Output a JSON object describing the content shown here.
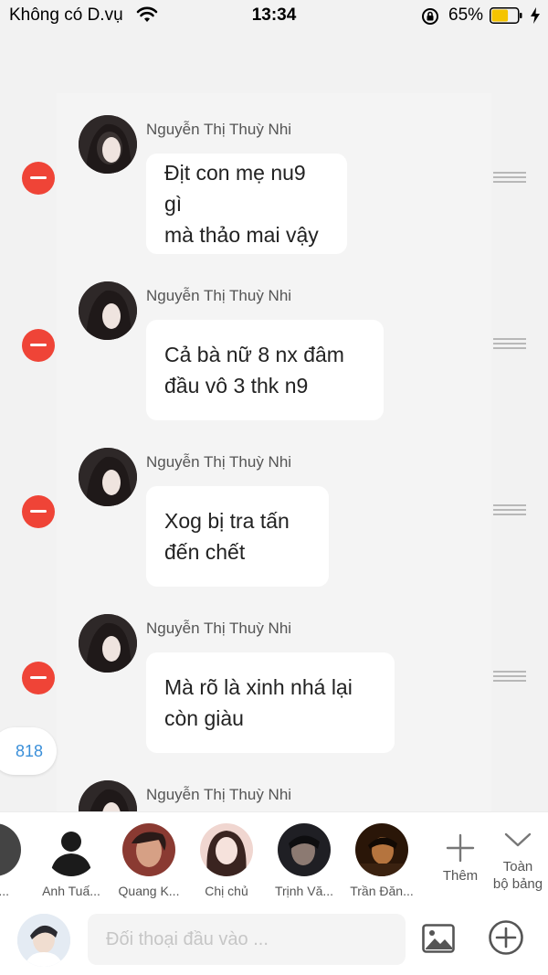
{
  "status_bar": {
    "carrier": "Không có D.vụ",
    "time": "13:34",
    "battery": "65%",
    "battery_fraction": 0.65,
    "battery_color": "#f5c400"
  },
  "messages": [
    {
      "sender": "Nguyễn Thị Thuỳ Nhi",
      "lines": [
        "Địt con mẹ nu9 gì",
        "mà thảo mai vậy"
      ]
    },
    {
      "sender": "Nguyễn Thị Thuỳ Nhi",
      "lines": [
        "Cả bà nữ 8 nx đâm",
        "đầu vô 3 thk n9"
      ]
    },
    {
      "sender": "Nguyễn Thị Thuỳ Nhi",
      "lines": [
        "Xog bị tra tấn",
        "đến chết"
      ]
    },
    {
      "sender": "Nguyễn Thị Thuỳ Nhi",
      "lines": [
        "Mà rõ là xinh nhá lại",
        "còn giàu"
      ]
    },
    {
      "sender": "Nguyễn Thị Thuỳ Nhi",
      "lines": []
    }
  ],
  "count_badge": "818",
  "members": [
    {
      "name": "i..."
    },
    {
      "name": "Anh Tuấ..."
    },
    {
      "name": "Quang K..."
    },
    {
      "name": "Chị chủ"
    },
    {
      "name": "Trịnh Vă..."
    },
    {
      "name": "Trần Đăn..."
    }
  ],
  "actions": {
    "add_label": "Thêm",
    "all_label_line1": "Toàn",
    "all_label_line2": "bộ bảng"
  },
  "input": {
    "placeholder": "Đối thoại đầu vào ..."
  },
  "colors": {
    "remove": "#ef4437",
    "badge_text": "#3a8fd9"
  },
  "icons": [
    "wifi-icon",
    "rotation-lock-icon",
    "battery-icon",
    "charging-bolt-icon",
    "remove-icon",
    "drag-handle-icon",
    "plus-icon",
    "chevron-down-icon",
    "image-icon",
    "add-circle-icon"
  ]
}
